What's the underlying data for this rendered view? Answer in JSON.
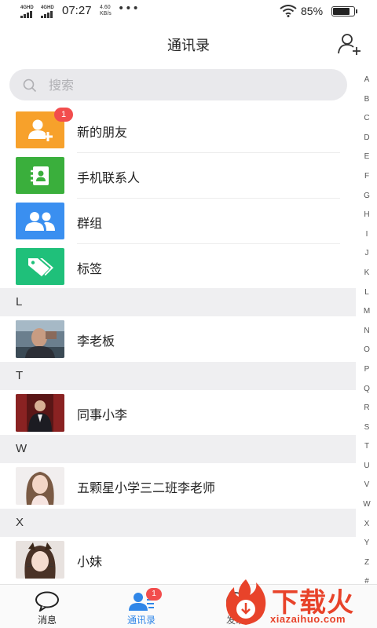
{
  "status_bar": {
    "sim1": "4GHD",
    "sim2": "4GHD",
    "time": "07:27",
    "speed_value": "4.60",
    "speed_unit": "KB/s",
    "battery": "85%",
    "battery_level": 0.85,
    "icons": [
      "signal-icon",
      "wifi-icon",
      "battery-icon"
    ]
  },
  "header": {
    "title": "通讯录",
    "add_contact_icon": "add-user-icon"
  },
  "search": {
    "placeholder": "搜索"
  },
  "functions": [
    {
      "label": "新的朋友",
      "icon": "person-add-icon",
      "color": "#f7a12b",
      "badge": "1"
    },
    {
      "label": "手机联系人",
      "icon": "contact-book-icon",
      "color": "#3aaf3c"
    },
    {
      "label": "群组",
      "icon": "group-icon",
      "color": "#3a8ff0"
    },
    {
      "label": "标签",
      "icon": "tags-icon",
      "color": "#1fc07a"
    }
  ],
  "sections": [
    {
      "letter": "L",
      "contacts": [
        {
          "name": "李老板"
        }
      ]
    },
    {
      "letter": "T",
      "contacts": [
        {
          "name": "同事小李"
        }
      ]
    },
    {
      "letter": "W",
      "contacts": [
        {
          "name": "五颗星小学三二班李老师"
        }
      ]
    },
    {
      "letter": "X",
      "contacts": [
        {
          "name": "小妹"
        }
      ]
    }
  ],
  "alphabet": [
    "A",
    "B",
    "C",
    "D",
    "E",
    "F",
    "G",
    "H",
    "I",
    "J",
    "K",
    "L",
    "M",
    "N",
    "O",
    "P",
    "Q",
    "R",
    "S",
    "T",
    "U",
    "V",
    "W",
    "X",
    "Y",
    "Z",
    "#"
  ],
  "bottom_nav": [
    {
      "label": "消息",
      "icon": "chat-bubble-icon",
      "active": false
    },
    {
      "label": "通讯录",
      "icon": "contacts-icon",
      "active": true,
      "badge": "1"
    },
    {
      "label": "发现",
      "icon": "discover-icon",
      "active": false
    }
  ],
  "watermark": {
    "text": "下载火",
    "url": "xiazaihuo.com"
  },
  "colors": {
    "accent": "#2f86e8",
    "badge": "#f24d4d",
    "section_bg": "#efeff1",
    "watermark": "#e8432a"
  }
}
